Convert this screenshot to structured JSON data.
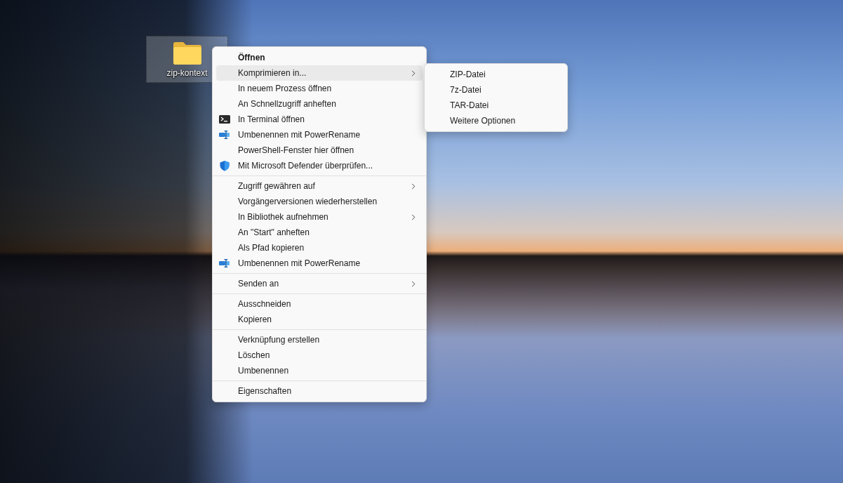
{
  "desktop_icons": [
    {
      "label": "zip-kontext",
      "selected": true
    }
  ],
  "context_menu": {
    "groups": [
      {
        "items": [
          {
            "label": "Öffnen",
            "default": true,
            "has_submenu": false,
            "selected": false
          },
          {
            "label": "Komprimieren in...",
            "default": false,
            "has_submenu": true,
            "selected": true
          },
          {
            "label": "In neuem Prozess öffnen",
            "default": false,
            "has_submenu": false,
            "selected": false
          },
          {
            "label": "An Schnellzugriff anheften",
            "default": false,
            "has_submenu": false,
            "selected": false
          },
          {
            "label": "In Terminal öffnen",
            "kind": "terminal",
            "default": false,
            "has_submenu": false,
            "selected": false
          },
          {
            "label": "Umbenennen mit PowerRename",
            "kind": "rename",
            "default": false,
            "has_submenu": false,
            "selected": false
          },
          {
            "label": "PowerShell-Fenster hier öffnen",
            "default": false,
            "has_submenu": false,
            "selected": false
          },
          {
            "label": "Mit Microsoft Defender überprüfen...",
            "kind": "defender",
            "default": false,
            "has_submenu": false,
            "selected": false
          }
        ]
      },
      {
        "items": [
          {
            "label": "Zugriff gewähren auf",
            "default": false,
            "has_submenu": true,
            "selected": false
          },
          {
            "label": "Vorgängerversionen wiederherstellen",
            "default": false,
            "has_submenu": false,
            "selected": false
          },
          {
            "label": "In Bibliothek aufnehmen",
            "default": false,
            "has_submenu": true,
            "selected": false
          },
          {
            "label": "An \"Start\" anheften",
            "default": false,
            "has_submenu": false,
            "selected": false
          },
          {
            "label": "Als Pfad kopieren",
            "default": false,
            "has_submenu": false,
            "selected": false
          },
          {
            "label": "Umbenennen mit PowerRename",
            "kind": "rename",
            "default": false,
            "has_submenu": false,
            "selected": false
          }
        ]
      },
      {
        "items": [
          {
            "label": "Senden an",
            "default": false,
            "has_submenu": true,
            "selected": false
          }
        ]
      },
      {
        "items": [
          {
            "label": "Ausschneiden",
            "default": false,
            "has_submenu": false,
            "selected": false
          },
          {
            "label": "Kopieren",
            "default": false,
            "has_submenu": false,
            "selected": false
          }
        ]
      },
      {
        "items": [
          {
            "label": "Verknüpfung erstellen",
            "default": false,
            "has_submenu": false,
            "selected": false
          },
          {
            "label": "Löschen",
            "default": false,
            "has_submenu": false,
            "selected": false
          },
          {
            "label": "Umbenennen",
            "default": false,
            "has_submenu": false,
            "selected": false
          }
        ]
      },
      {
        "items": [
          {
            "label": "Eigenschaften",
            "default": false,
            "has_submenu": false,
            "selected": false
          }
        ]
      }
    ]
  },
  "submenu": {
    "items": [
      {
        "label": "ZIP-Datei",
        "selected": false
      },
      {
        "label": "7z-Datei",
        "selected": false
      },
      {
        "label": "TAR-Datei",
        "selected": false
      },
      {
        "label": "Weitere Optionen",
        "selected": false
      }
    ]
  }
}
